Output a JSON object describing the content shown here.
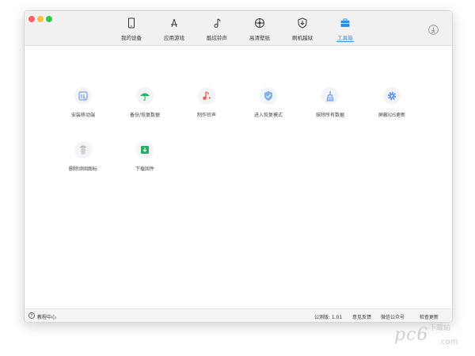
{
  "tabs": [
    {
      "label": "我的设备",
      "icon": "phone-icon",
      "active": false
    },
    {
      "label": "应用游戏",
      "icon": "app-store-icon",
      "active": false
    },
    {
      "label": "酷炫铃声",
      "icon": "music-note-icon",
      "active": false
    },
    {
      "label": "高清壁纸",
      "icon": "flower-icon",
      "active": false
    },
    {
      "label": "刷机越狱",
      "icon": "shield-download-icon",
      "active": false
    },
    {
      "label": "工具箱",
      "icon": "toolbox-icon",
      "active": true
    }
  ],
  "tools": [
    {
      "label": "安装移动端",
      "icon": "install-mobile-icon",
      "color": "#4a90e2"
    },
    {
      "label": "备份/恢复数据",
      "icon": "umbrella-icon",
      "color": "#27ae60"
    },
    {
      "label": "制作铃声",
      "icon": "ringtone-icon",
      "color": "#ef5d4d"
    },
    {
      "label": "进入恢复模式",
      "icon": "shield-check-icon",
      "color": "#4a90e2"
    },
    {
      "label": "抹除所有数据",
      "icon": "broom-icon",
      "color": "#5b8ee6"
    },
    {
      "label": "屏蔽iOS更新",
      "icon": "gear-icon",
      "color": "#5b8ee6"
    },
    {
      "label": "删除顽固图标",
      "icon": "trash-icon",
      "color": "#b0b0b0"
    },
    {
      "label": "下载固件",
      "icon": "download-firmware-icon",
      "color": "#27ae60"
    }
  ],
  "status": {
    "help": "教程中心",
    "version": "公测版: 1.01",
    "feedback": "意见反馈",
    "wechat": "微信公众号",
    "update": "检查更新"
  },
  "watermark": {
    "brand": "pc6",
    "cn": "下载站",
    "suffix": ".com"
  },
  "colors": {
    "accent": "#2f8ee6"
  }
}
